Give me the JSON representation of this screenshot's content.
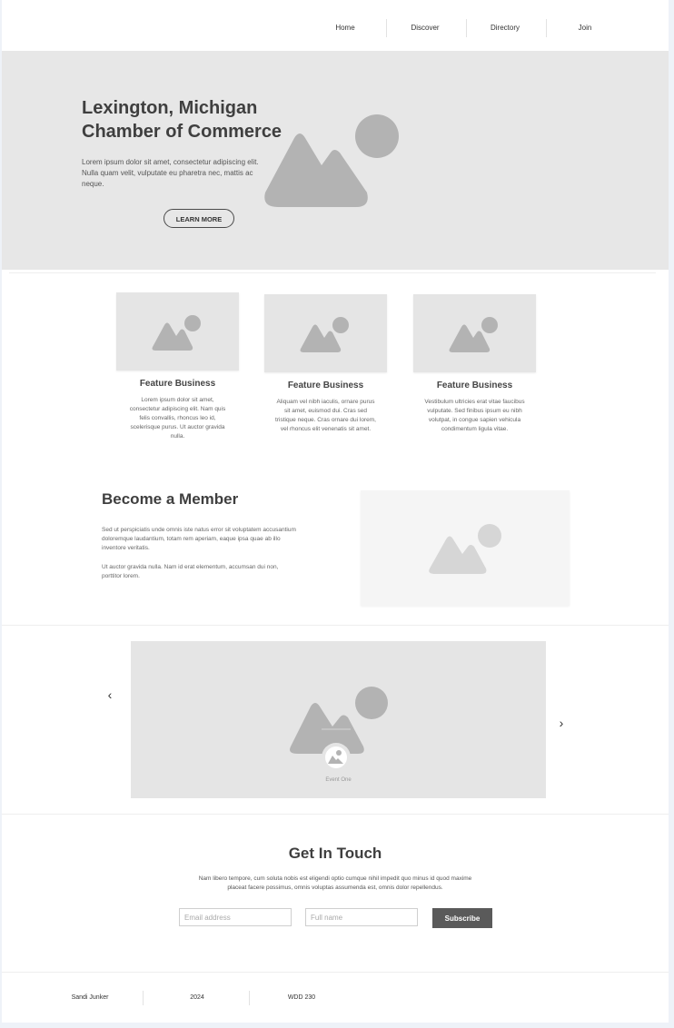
{
  "nav": {
    "items": [
      "Home",
      "Discover",
      "Directory",
      "Join"
    ]
  },
  "hero": {
    "title": "Lexington, Michigan Chamber of Commerce",
    "description": "Lorem ipsum dolor sit amet, consectetur adipiscing elit. Nulla quam velit, vulputate eu pharetra nec, mattis ac neque.",
    "button_label": "LEARN MORE",
    "image_icon": "image-placeholder-icon"
  },
  "features": [
    {
      "title": "Feature Business",
      "description": "Lorem ipsum dolor sit amet, consectetur adipiscing elit. Nam quis felis convallis, rhoncus leo id, scelerisque purus. Ut auctor gravida nulla."
    },
    {
      "title": "Feature Business",
      "description": "Aliquam vel nibh iaculis, ornare purus sit amet, euismod dui. Cras sed tristique neque. Cras ornare dui lorem, vel rhoncus elit venenatis sit amet."
    },
    {
      "title": "Feature Business",
      "description": "Vestibulum ultricies erat vitae faucibus vulputate. Sed finibus ipsum eu nibh volutpat, in congue sapien vehicula condimentum ligula vitae."
    }
  ],
  "member": {
    "title": "Become a Member",
    "paragraph1": "Sed ut perspiciatis unde omnis iste natus error sit voluptatem accusantium doloremque laudantium, totam rem aperiam, eaque ipsa quae ab illo inventore veritatis.",
    "paragraph2": "Ut auctor gravida nulla. Nam id erat elementum, accumsan dui non, porttitor lorem."
  },
  "carousel": {
    "caption": "Event One",
    "prev_icon": "chevron-left-icon",
    "next_icon": "chevron-right-icon"
  },
  "contact": {
    "title": "Get In Touch",
    "description": "Nam libero tempore, cum soluta nobis est eligendi optio cumque nihil impedit quo minus id quod maxime placeat facere possimus, omnis voluptas assumenda est, omnis dolor repellendus.",
    "email_placeholder": "Email address",
    "name_placeholder": "Full name",
    "subscribe_label": "Subscribe"
  },
  "footer": {
    "author": "Sandi Junker",
    "year": "2024",
    "course": "WDD 230"
  },
  "colors": {
    "hero_bg": "#e7e7e7",
    "placeholder_gray": "#b3b3b3",
    "subscribe_bg": "#5a5a5a",
    "heading_text": "#3f3f3f"
  }
}
